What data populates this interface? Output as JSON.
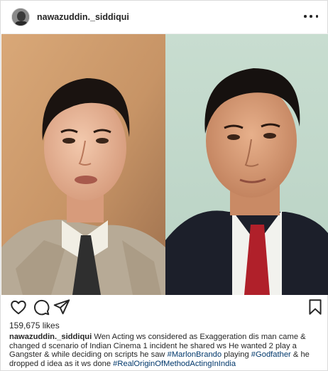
{
  "post": {
    "username": "nawazuddin._siddiqui",
    "likes": "159,675 likes",
    "caption": {
      "username": "nawazuddin._siddiqui",
      "text_1": " Wen Acting ws considered as Exaggeration dis man came & changed d scenario of Indian Cinema 1 incident he shared ws He wanted 2 play a Gangster & while deciding on scripts he saw ",
      "tag_1": "#MarlonBrando",
      "text_2": " playing ",
      "tag_2": "#Godfather",
      "text_3": " & he dropped d idea as it ws done ",
      "tag_3": "#RealOriginOfMethodActingInIndia"
    }
  },
  "icons": {
    "more": "more-options-icon",
    "like": "heart-icon",
    "comment": "comment-icon",
    "share": "share-icon",
    "save": "bookmark-icon"
  },
  "colors": {
    "text": "#262626",
    "hashtag": "#00376b",
    "border": "#dbdbdb"
  }
}
